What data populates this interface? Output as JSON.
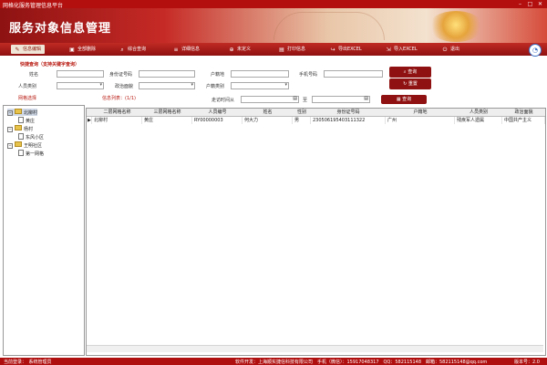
{
  "window": {
    "title": "网格化服务管理信息平台",
    "min": "–",
    "max": "□",
    "close": "✕"
  },
  "banner": {
    "title": "服务对象信息管理"
  },
  "toolbar": {
    "items": [
      {
        "label": "信息编辑",
        "icon": "edit-icon"
      },
      {
        "label": "全部删除",
        "icon": "trash-icon"
      },
      {
        "label": "综合查询",
        "icon": "search-icon"
      },
      {
        "label": "详细信息",
        "icon": "list-icon"
      },
      {
        "label": "未定义",
        "icon": "circle-plus-icon"
      },
      {
        "label": "打印信息",
        "icon": "print-icon"
      },
      {
        "label": "导出EXCEL",
        "icon": "export-icon"
      },
      {
        "label": "导入EXCEL",
        "icon": "import-icon"
      },
      {
        "label": "退出",
        "icon": "exit-icon"
      }
    ]
  },
  "quick_search": {
    "title": "快捷查询（支持关键字查询）",
    "name_label": "姓名",
    "id_label": "身份证号码",
    "household_label": "户籍地",
    "phone_label": "手机号码",
    "person_type_label": "人员类别",
    "political_label": "政治面貌",
    "household_type_label": "户籍类别",
    "search_button": "查询",
    "reset_button": "重置"
  },
  "network_select_label": "网格选择",
  "info_list": {
    "label": "信息列表：",
    "count": "(1/1)"
  },
  "date_filter": {
    "label": "走访时间从",
    "to": "至",
    "query_button": "查询"
  },
  "tree": {
    "nodes": [
      {
        "label": "北柳村"
      },
      {
        "label": "黄庄"
      },
      {
        "label": "杨村"
      },
      {
        "label": "东风小区"
      },
      {
        "label": "王明社区"
      },
      {
        "label": "第一网格"
      }
    ]
  },
  "table": {
    "columns": [
      "二层网格名称",
      "三层网格名称",
      "人员编号",
      "姓名",
      "性别",
      "身份证号码",
      "户籍地",
      "人员类别",
      "政治面貌"
    ],
    "rows": [
      [
        "北柳村",
        "黄庄",
        "RY00000003",
        "何大力",
        "男",
        "230506195403111322",
        "广州",
        "残疾军人遗属",
        "中国共产主义"
      ]
    ]
  },
  "status": {
    "user": "当前登录：　系统管理员",
    "dev": "软件开发：上海顺实捷信科技有限公司　手机（微信）：15917048317　QQ：582115148　邮箱：582115148@qq.com",
    "version": "版本号：2.0"
  },
  "colors": {
    "brand_red": "#b00f0f",
    "accent_red": "#8f1111",
    "gold": "#e6a43c"
  }
}
